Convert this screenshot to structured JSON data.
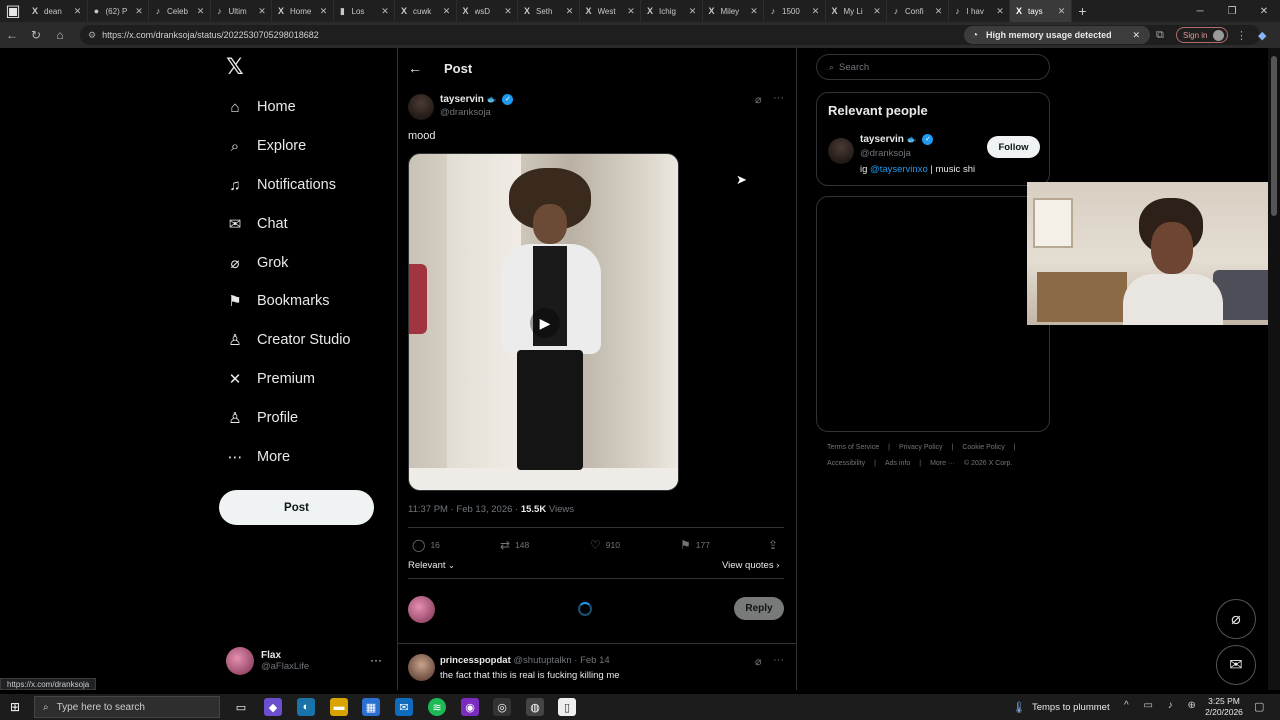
{
  "browser": {
    "tabs": [
      {
        "label": "dean",
        "favicon": "X",
        "active": false
      },
      {
        "label": "(62) P",
        "favicon": "●",
        "active": false
      },
      {
        "label": "Celeb",
        "favicon": "♪",
        "active": false
      },
      {
        "label": "Ultim",
        "favicon": "♪",
        "active": false
      },
      {
        "label": "Home",
        "favicon": "X",
        "active": false
      },
      {
        "label": "Los",
        "favicon": "▮",
        "active": false
      },
      {
        "label": "cuwk",
        "favicon": "X",
        "active": false
      },
      {
        "label": "wsD",
        "favicon": "X",
        "active": false
      },
      {
        "label": "Seth",
        "favicon": "X",
        "active": false
      },
      {
        "label": "West",
        "favicon": "X",
        "active": false
      },
      {
        "label": "Ichig",
        "favicon": "X",
        "active": false
      },
      {
        "label": "Miley",
        "favicon": "X",
        "active": false
      },
      {
        "label": "1500",
        "favicon": "♪",
        "active": false
      },
      {
        "label": "My Li",
        "favicon": "X",
        "active": false
      },
      {
        "label": "Confi",
        "favicon": "♪",
        "active": false
      },
      {
        "label": "I hav",
        "favicon": "♪",
        "active": false
      },
      {
        "label": "tays",
        "favicon": "X",
        "active": true
      }
    ],
    "url": "https://x.com/dranksoja/status/2022530705298018682",
    "memory_alert": "High memory usage detected",
    "sign_in_label": "Sign in",
    "hover_url": "https://x.com/dranksoja"
  },
  "nav": {
    "items": [
      {
        "label": "Home",
        "icon": "home-icon",
        "glyph": "⌂"
      },
      {
        "label": "Explore",
        "icon": "search-icon",
        "glyph": "⌕"
      },
      {
        "label": "Notifications",
        "icon": "bell-icon",
        "glyph": "♫"
      },
      {
        "label": "Chat",
        "icon": "mail-icon",
        "glyph": "✉"
      },
      {
        "label": "Grok",
        "icon": "grok-icon",
        "glyph": "⌀"
      },
      {
        "label": "Bookmarks",
        "icon": "bookmark-icon",
        "glyph": "⚑"
      },
      {
        "label": "Creator Studio",
        "icon": "creator-studio-icon",
        "glyph": "♙"
      },
      {
        "label": "Premium",
        "icon": "x-premium-icon",
        "glyph": "✕"
      },
      {
        "label": "Profile",
        "icon": "profile-icon",
        "glyph": "♙"
      },
      {
        "label": "More",
        "icon": "more-circle-icon",
        "glyph": "⋯"
      }
    ],
    "post_button": "Post",
    "account": {
      "name": "Flax",
      "handle": "@aFlaxLife"
    }
  },
  "post": {
    "header_title": "Post",
    "author_name": "tayservin",
    "author_emoji": "🐟",
    "author_handle": "@dranksoja",
    "text": "mood",
    "timestamp": "11:37 PM · Feb 13, 2026 ·",
    "views_count": "15.5K",
    "views_label": "Views",
    "stats": {
      "replies": "16",
      "reposts": "148",
      "likes": "910",
      "bookmarks": "177"
    },
    "sort_label": "Relevant",
    "view_quotes_label": "View quotes",
    "reply_button": "Reply"
  },
  "reply": {
    "name": "princesspopdat",
    "handle": "@shutuptalkn",
    "date": "· Feb 14",
    "text": "the fact that this is real is fucking killing me"
  },
  "sidebar": {
    "search_placeholder": "Search",
    "relevant_title": "Relevant people",
    "person": {
      "name": "tayservin",
      "handle": "@dranksoja",
      "bio_prefix": "ig",
      "bio_link": "@tayservinxo",
      "bio_suffix": "| music shi",
      "follow_label": "Follow"
    },
    "footer_row1": [
      "Terms of Service",
      "|",
      "Privacy Policy",
      "|",
      "Cookie Policy",
      "|"
    ],
    "footer_row2": [
      "Accessibility",
      "|",
      "Ads info",
      "|",
      "More ···",
      "© 2026 X Corp."
    ]
  },
  "taskbar": {
    "search_placeholder": "Type here to search",
    "weather": "Temps to plummet",
    "time": "3:25 PM",
    "date": "2/20/2026"
  },
  "colors": {
    "background": "#000000",
    "text_primary": "#e7e9ea",
    "text_secondary": "#71767b",
    "accent": "#1d9bf0",
    "border": "#2f3336"
  }
}
